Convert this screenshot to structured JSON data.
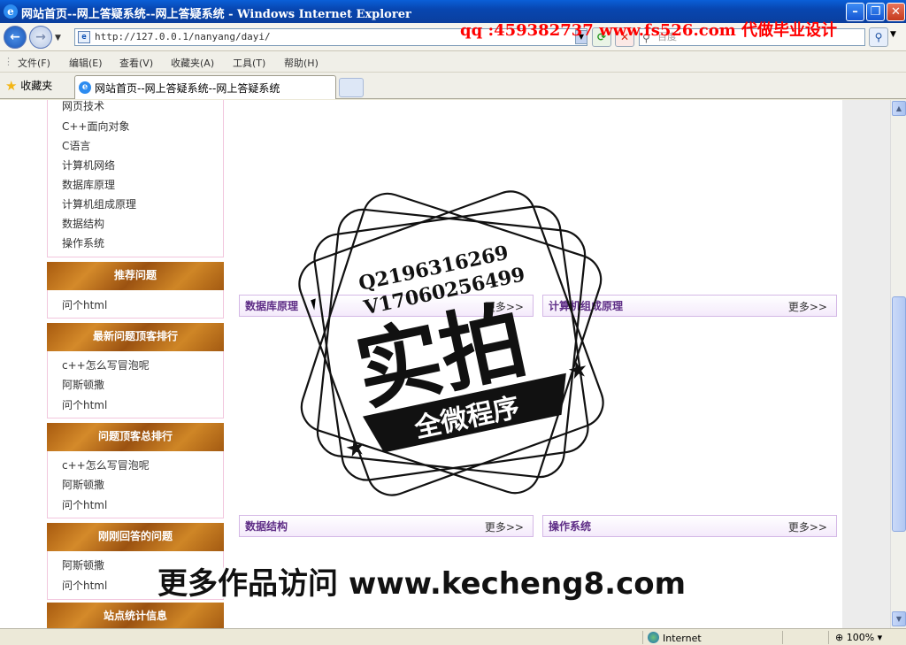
{
  "window": {
    "title": "网站首页--网上答疑系统--网上答疑系统 - Windows Internet Explorer",
    "minimize": "–",
    "restore": "❐",
    "close": "✕"
  },
  "overlay": {
    "qq": "qq :459382737 www.fs526.com 代做毕业设计",
    "bottom": "更多作品访问 www.kecheng8.com",
    "stamp_line1": "Q2196316269",
    "stamp_line2": "V17060256499",
    "stamp_main": "实拍",
    "stamp_banner": "全微程序"
  },
  "address": {
    "url": "http://127.0.0.1/nanyang/dayi/",
    "search_placeholder": "百度"
  },
  "menu": [
    "文件(F)",
    "编辑(E)",
    "查看(V)",
    "收藏夹(A)",
    "工具(T)",
    "帮助(H)"
  ],
  "favorites": "收藏夹",
  "tab": {
    "title": "网站首页--网上答疑系统--网上答疑系统"
  },
  "sidebar": {
    "categories": [
      "网页技术",
      "C++面向对象",
      "C语言",
      "计算机网络",
      "数据库原理",
      "计算机组成原理",
      "数据结构",
      "操作系统"
    ],
    "recommended": {
      "title": "推荐问题",
      "items": [
        "问个html"
      ]
    },
    "latest": {
      "title": "最新问题顶客排行",
      "items": [
        "c++怎么写冒泡呢",
        "阿斯顿撒",
        "问个html"
      ]
    },
    "top": {
      "title": "问题顶客总排行",
      "items": [
        "c++怎么写冒泡呢",
        "阿斯顿撒",
        "问个html"
      ]
    },
    "answered": {
      "title": "刚刚回答的问题",
      "items": [
        "阿斯顿撒",
        "问个html"
      ]
    },
    "stats": {
      "title": "站点统计信息"
    }
  },
  "main": {
    "more": "更多>>",
    "boxes": [
      {
        "title": "数据库原理"
      },
      {
        "title": "计算机组成原理"
      },
      {
        "title": "数据结构"
      },
      {
        "title": "操作系统"
      }
    ]
  },
  "status": {
    "zone": "Internet",
    "zoom": "100%"
  }
}
